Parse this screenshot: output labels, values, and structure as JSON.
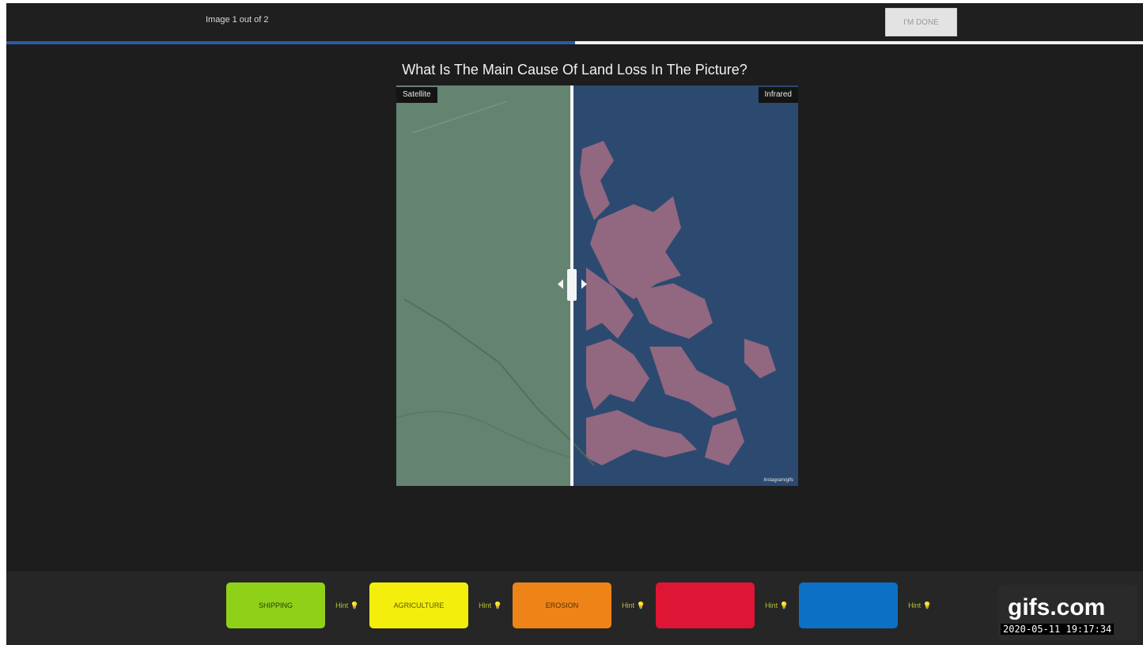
{
  "header": {
    "counter": "Image 1 out of 2",
    "done_label": "I'M DONE",
    "progress_percent": 50
  },
  "question": "What Is The Main Cause Of Land Loss In The Picture?",
  "viewer": {
    "left_label": "Satellite",
    "right_label": "Infrared",
    "watermark": "Instagram/gifs",
    "slider_percent": 44
  },
  "answers": [
    {
      "label": "SHIPPING",
      "color": "#8fd119",
      "text_color": "#2a3d08",
      "hint": "Hint"
    },
    {
      "label": "AGRICULTURE",
      "color": "#f4ee0c",
      "text_color": "#5c5700",
      "hint": "Hint"
    },
    {
      "label": "EROSION",
      "color": "#ee8418",
      "text_color": "#5a2d05",
      "hint": "Hint"
    },
    {
      "label": "",
      "color": "#df1535",
      "text_color": "#6b0a19",
      "hint": "Hint"
    },
    {
      "label": "",
      "color": "#0c71c4",
      "text_color": "#063a66",
      "hint": "Hint"
    }
  ],
  "icons": {
    "hint": "lightbulb-icon"
  },
  "badge": {
    "logo": "gifs.com",
    "timestamp": "2020-05-11 19:17:34"
  }
}
